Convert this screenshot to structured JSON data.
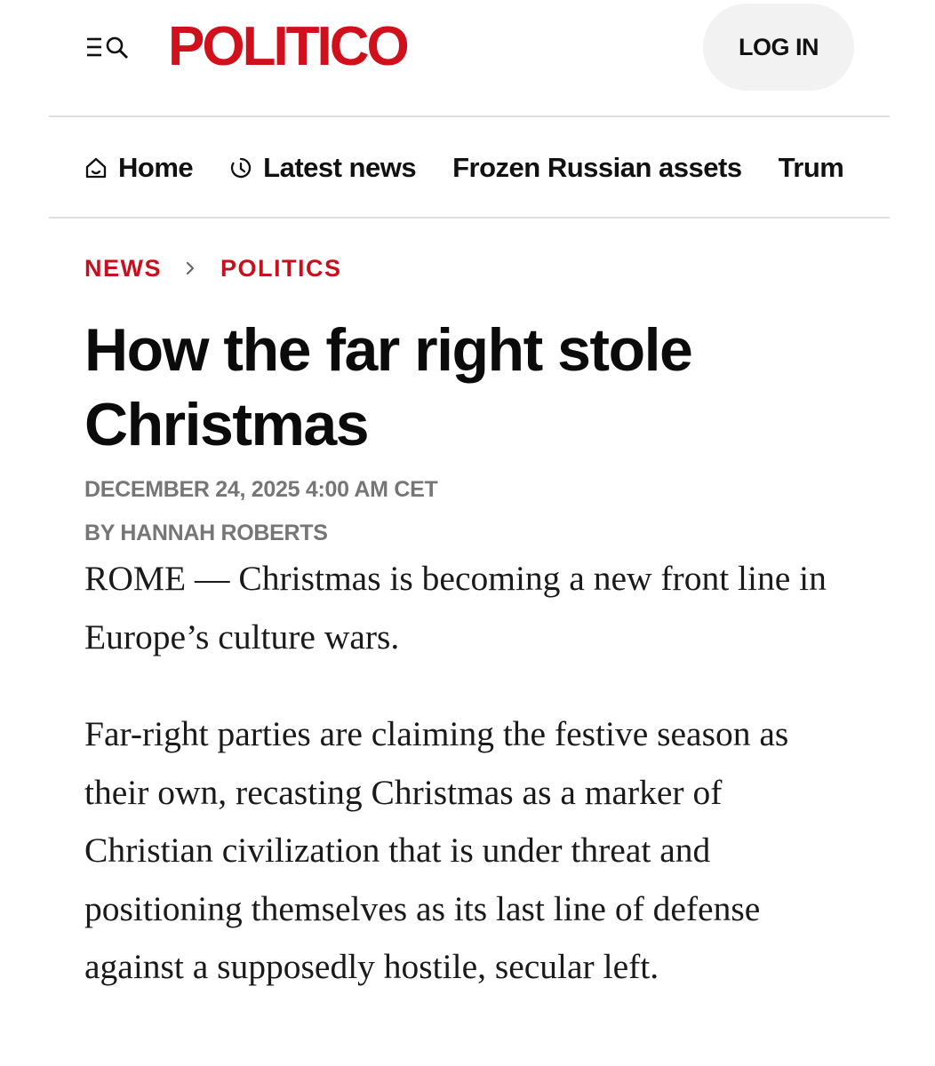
{
  "header": {
    "logo": "POLITICO",
    "login_label": "LOG IN",
    "menu_icon": "menu-search-icon"
  },
  "nav": {
    "items": [
      {
        "label": "Home",
        "icon": "home-icon"
      },
      {
        "label": "Latest news",
        "icon": "clock-icon"
      },
      {
        "label": "Frozen Russian assets"
      },
      {
        "label": "Trum"
      }
    ]
  },
  "breadcrumb": {
    "items": [
      "NEWS",
      "POLITICS"
    ],
    "separator_icon": "chevron-right-icon"
  },
  "article": {
    "headline": "How the far right stole Christmas",
    "dateline": "DECEMBER 24, 2025 4:00 AM CET",
    "byline": "BY HANNAH ROBERTS",
    "paragraphs": [
      "ROME — Christmas is becoming a new front line in Europe’s culture wars.",
      "Far-right parties are claiming the festive season as their own, recasting Christmas as a marker of Christian civilization that is under threat and positioning themselves as its last line of defense against a supposedly hostile, secular left."
    ]
  },
  "colors": {
    "brand": "#d0111b",
    "breadcrumb": "#c8101c",
    "meta": "#767676",
    "login_bg": "#f2f2f2"
  }
}
